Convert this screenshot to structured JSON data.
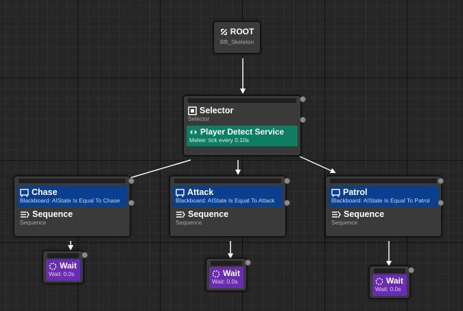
{
  "root": {
    "title": "ROOT",
    "subtitle": "BB_Skeleton"
  },
  "selector": {
    "title": "Selector",
    "subtitle": "Selector",
    "service": {
      "title": "Player Detect Service",
      "subtitle": "Melee: tick every 0.10s"
    }
  },
  "branches": [
    {
      "decorator_title": "Chase",
      "decorator_subtitle": "Blackboard: AIState Is Equal To Chase",
      "composite_title": "Sequence",
      "composite_subtitle": "Sequence"
    },
    {
      "decorator_title": "Attack",
      "decorator_subtitle": "Blackboard: AIState Is Equal To Attack",
      "composite_title": "Sequence",
      "composite_subtitle": "Sequence"
    },
    {
      "decorator_title": "Patrol",
      "decorator_subtitle": "Blackboard: AIState Is Equal To Patrol",
      "composite_title": "Sequence",
      "composite_subtitle": "Sequence"
    }
  ],
  "waits": [
    {
      "title": "Wait",
      "subtitle": "Wait: 0.0s"
    },
    {
      "title": "Wait",
      "subtitle": "Wait: 0.0s"
    },
    {
      "title": "Wait",
      "subtitle": "Wait: 0.0s"
    }
  ],
  "colors": {
    "decorator": "#0a3f8f",
    "service": "#0d7e64",
    "task": "#6a2cb0",
    "node": "#3a3a3a",
    "wire": "#ffffff"
  },
  "icons": {
    "root": "root-arrows-icon",
    "selector": "selector-icon",
    "service": "service-icon",
    "decorator": "blackboard-decorator-icon",
    "sequence": "sequence-icon",
    "wait": "wait-icon"
  }
}
